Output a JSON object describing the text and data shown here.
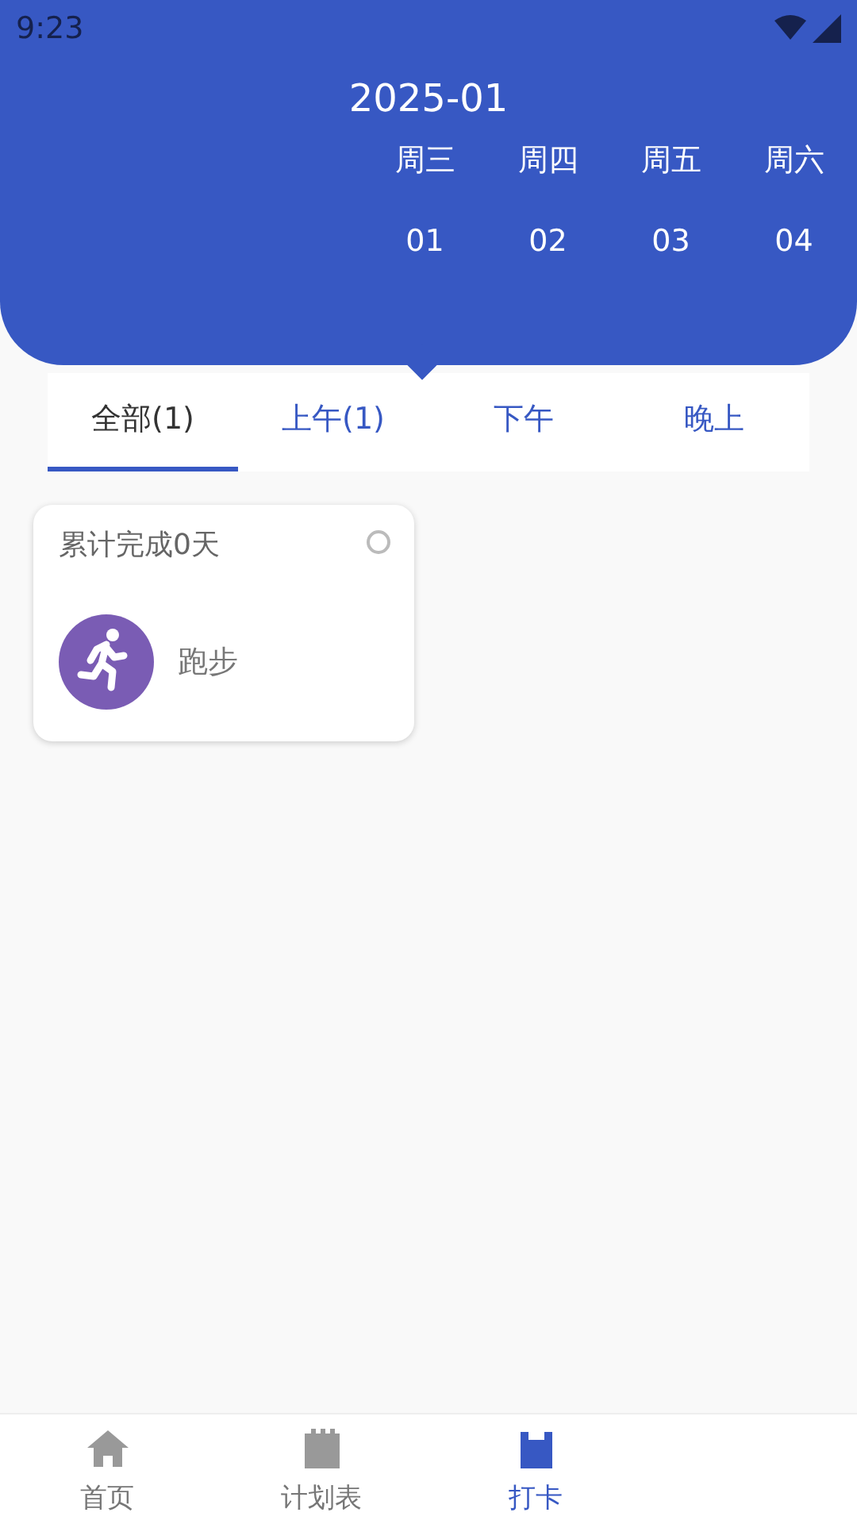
{
  "status_bar": {
    "time": "9:23"
  },
  "header": {
    "month": "2025-01",
    "days": [
      {
        "weekday": "周三",
        "date": "01"
      },
      {
        "weekday": "周四",
        "date": "02"
      },
      {
        "weekday": "周五",
        "date": "03"
      },
      {
        "weekday": "周六",
        "date": "04"
      }
    ]
  },
  "tabs": [
    {
      "label": "全部(1)",
      "selected": true
    },
    {
      "label": "上午(1)",
      "selected": false
    },
    {
      "label": "下午",
      "selected": false
    },
    {
      "label": "晚上",
      "selected": false
    }
  ],
  "habits": [
    {
      "summary": "累计完成0天",
      "name": "跑步",
      "checked": false,
      "color": "#7a5cb4"
    }
  ],
  "bottom_nav": [
    {
      "label": "首页",
      "kind": "home",
      "selected": false
    },
    {
      "label": "计划表",
      "kind": "plan",
      "selected": false
    },
    {
      "label": "打卡",
      "kind": "checkin",
      "selected": true
    }
  ]
}
